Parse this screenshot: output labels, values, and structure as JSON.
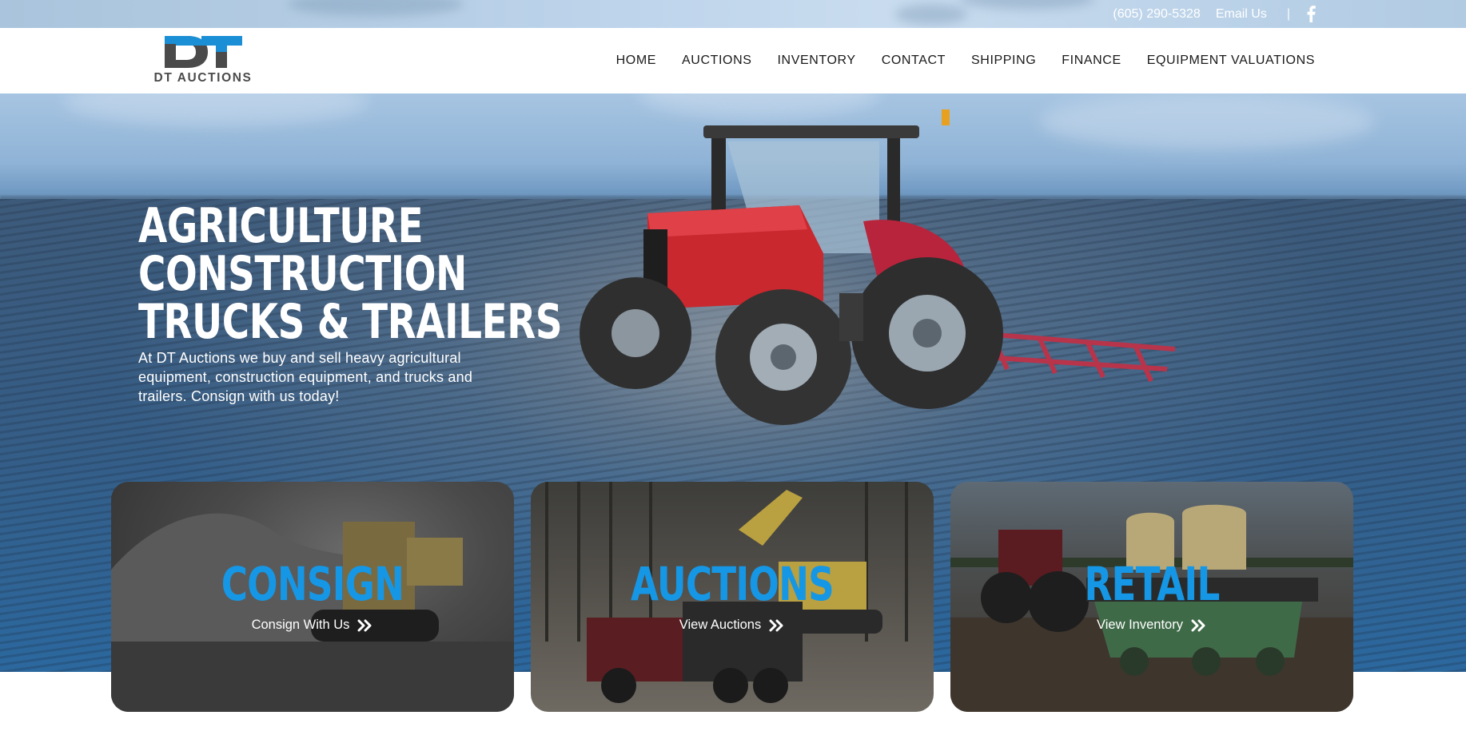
{
  "topbar": {
    "phone": "(605) 290-5328",
    "email_label": "Email Us",
    "separator": "|",
    "social_icon": "facebook-icon"
  },
  "brand": {
    "logo_letters": "DT",
    "name": "DT AUCTIONS",
    "accent_color": "#1597e5",
    "dark_color": "#4b4b4b"
  },
  "nav": {
    "items": [
      {
        "label": "HOME"
      },
      {
        "label": "AUCTIONS"
      },
      {
        "label": "INVENTORY"
      },
      {
        "label": "CONTACT"
      },
      {
        "label": "SHIPPING"
      },
      {
        "label": "FINANCE"
      },
      {
        "label": "EQUIPMENT VALUATIONS"
      }
    ]
  },
  "hero": {
    "headline_lines": [
      "AGRICULTURE",
      "CONSTRUCTION",
      "TRUCKS & TRAILERS"
    ],
    "subtitle": "At DT Auctions we buy and sell heavy agricultural equipment, construction equipment, and trucks and trailers. Consign with us today!"
  },
  "cards": [
    {
      "title": "CONSIGN",
      "link": "Consign With Us",
      "icon": "double-chevron-right-icon"
    },
    {
      "title": "AUCTIONS",
      "link": "View Auctions",
      "icon": "double-chevron-right-icon"
    },
    {
      "title": "RETAIL",
      "link": "View Inventory",
      "icon": "double-chevron-right-icon"
    }
  ]
}
